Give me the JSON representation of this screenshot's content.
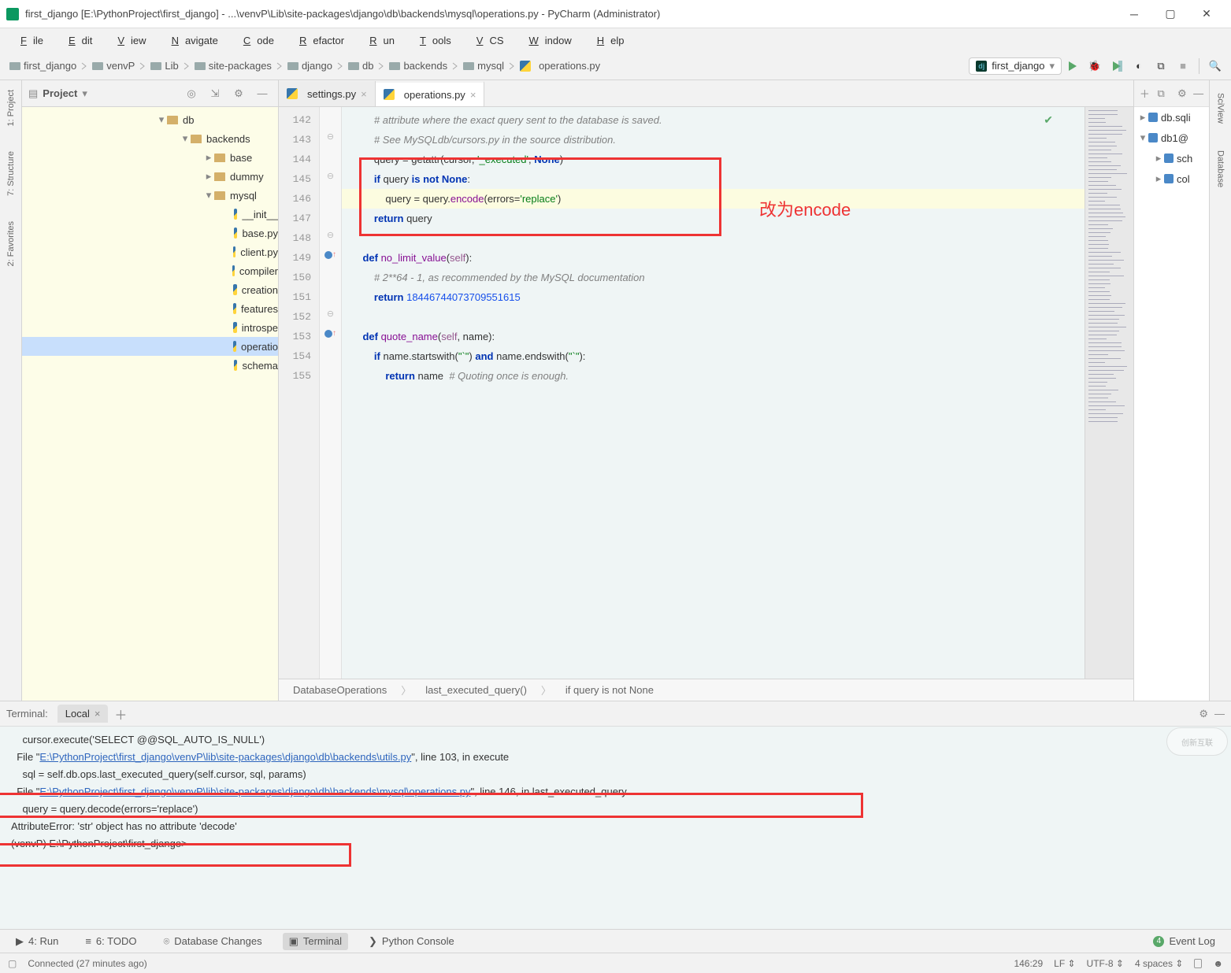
{
  "titlebar": {
    "text": "first_django [E:\\PythonProject\\first_django] - ...\\venvP\\Lib\\site-packages\\django\\db\\backends\\mysql\\operations.py - PyCharm (Administrator)"
  },
  "menubar": [
    "File",
    "Edit",
    "View",
    "Navigate",
    "Code",
    "Refactor",
    "Run",
    "Tools",
    "VCS",
    "Window",
    "Help"
  ],
  "breadcrumb": [
    "first_django",
    "venvP",
    "Lib",
    "site-packages",
    "django",
    "db",
    "backends",
    "mysql",
    "operations.py"
  ],
  "run_config": "first_django",
  "project_panel": {
    "title": "Project",
    "tree": [
      {
        "label": "db",
        "ind": 170,
        "kind": "dir",
        "open": true
      },
      {
        "label": "backends",
        "ind": 200,
        "kind": "dir",
        "open": true
      },
      {
        "label": "base",
        "ind": 230,
        "kind": "dir",
        "open": false
      },
      {
        "label": "dummy",
        "ind": 230,
        "kind": "dir",
        "open": false
      },
      {
        "label": "mysql",
        "ind": 230,
        "kind": "dir",
        "open": true
      },
      {
        "label": "__init__",
        "ind": 264,
        "kind": "py"
      },
      {
        "label": "base.py",
        "ind": 264,
        "kind": "py"
      },
      {
        "label": "client.py",
        "ind": 264,
        "kind": "py"
      },
      {
        "label": "compiler",
        "ind": 264,
        "kind": "py"
      },
      {
        "label": "creation",
        "ind": 264,
        "kind": "py"
      },
      {
        "label": "features",
        "ind": 264,
        "kind": "py"
      },
      {
        "label": "introspe",
        "ind": 264,
        "kind": "py"
      },
      {
        "label": "operatio",
        "ind": 264,
        "kind": "py",
        "sel": true
      },
      {
        "label": "schema",
        "ind": 264,
        "kind": "py"
      }
    ]
  },
  "tabs": [
    {
      "label": "settings.py",
      "active": false
    },
    {
      "label": "operations.py",
      "active": true
    }
  ],
  "gutter_lines": [
    "142",
    "143",
    "144",
    "145",
    "146",
    "147",
    "148",
    "149",
    "150",
    "151",
    "152",
    "153",
    "154",
    "155"
  ],
  "code_lines": [
    {
      "html": "        <span class='cmt'># attribute where the exact query sent to the database is saved.</span>"
    },
    {
      "html": "        <span class='cmt'># See MySQLdb/cursors.py in the source distribution.</span>"
    },
    {
      "html": "        query = getattr(cursor, <span class='str'>'_executed'</span>, <span class='kw'>None</span>)"
    },
    {
      "html": "        <span class='kw'>if</span> query <span class='kw'>is not</span> <span class='kw'>None</span>:"
    },
    {
      "html": "            query = query.<span class='fn'>encode</span>(errors=<span class='str'>'replace'</span>)",
      "hl": true
    },
    {
      "html": "        <span class='kw'>return</span> query"
    },
    {
      "html": ""
    },
    {
      "html": "    <span class='kw'>def</span> <span class='fn'>no_limit_value</span>(<span class='self'>self</span>):"
    },
    {
      "html": "        <span class='cmt'># 2**64 - 1, as recommended by the MySQL documentation</span>"
    },
    {
      "html": "        <span class='kw'>return</span> <span class='num'>18446744073709551615</span>"
    },
    {
      "html": ""
    },
    {
      "html": "    <span class='kw'>def</span> <span class='fn'>quote_name</span>(<span class='self'>self</span>, name):"
    },
    {
      "html": "        <span class='kw'>if</span> name.startswith(<span class='str'>\"`\"</span>) <span class='kw'>and</span> name.endswith(<span class='str'>\"`\"</span>):"
    },
    {
      "html": "            <span class='kw'>return</span> name  <span class='cmt'># Quoting once is enough.</span>"
    }
  ],
  "code_breadcrumb": [
    "DatabaseOperations",
    "last_executed_query()",
    "if query is not None"
  ],
  "annotation": "改为encode",
  "db_panel": {
    "items": [
      {
        "label": "db.sqli",
        "ind": 4,
        "arrow": "right"
      },
      {
        "label": "db1@",
        "ind": 4,
        "arrow": "down"
      },
      {
        "label": "sch",
        "ind": 24,
        "arrow": "right"
      },
      {
        "label": "col",
        "ind": 24,
        "arrow": "right"
      }
    ]
  },
  "right_vtabs": [
    "SciView",
    "Database"
  ],
  "left_vtabs": [
    "1: Project",
    "7: Structure",
    "2: Favorites"
  ],
  "terminal": {
    "header": "Terminal:",
    "tab": "Local",
    "lines": [
      {
        "txt": "    cursor.execute('SELECT @@SQL_AUTO_IS_NULL')"
      },
      {
        "pre": "  File \"",
        "link": "E:\\PythonProject\\first_django\\venvP\\lib\\site-packages\\django\\db\\backends\\utils.py",
        "post": "\", line 103, in execute"
      },
      {
        "txt": "    sql = self.db.ops.last_executed_query(self.cursor, sql, params)"
      },
      {
        "pre": "  File \"",
        "link": "E:\\PythonProject\\first_django\\venvP\\lib\\site-packages\\django\\db\\backends\\mysql\\operations.py",
        "post": "\", line 146, in last_executed_query"
      },
      {
        "txt": "    query = query.decode(errors='replace')"
      },
      {
        "txt": "AttributeError: 'str' object has no attribute 'decode'"
      },
      {
        "txt": ""
      },
      {
        "txt": ""
      },
      {
        "txt": "(venvP) E:\\PythonProject\\first_django>"
      }
    ]
  },
  "bottom_tools": [
    {
      "label": "4: Run",
      "icon": "▶"
    },
    {
      "label": "6: TODO",
      "icon": "≡"
    },
    {
      "label": "Database Changes",
      "icon": "⌾"
    },
    {
      "label": "Terminal",
      "icon": "▣",
      "active": true
    },
    {
      "label": "Python Console",
      "icon": "❯"
    }
  ],
  "event_log": {
    "count": "4",
    "label": "Event Log"
  },
  "statusbar": {
    "left": "Connected (27 minutes ago)",
    "pos": "146:29",
    "le": "LF",
    "enc": "UTF-8",
    "indent": "4 spaces"
  },
  "watermark": "创新互联"
}
